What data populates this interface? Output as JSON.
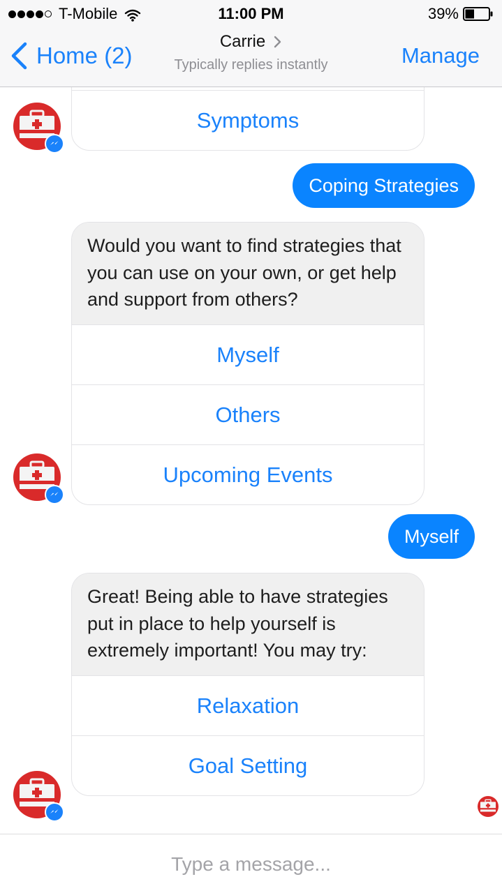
{
  "status_bar": {
    "carrier": "T-Mobile",
    "time": "11:00 PM",
    "battery": "39%",
    "battery_level": 0.39,
    "signal_bars": 4,
    "icons": [
      "signal-dots-icon",
      "wifi-icon",
      "battery-icon"
    ]
  },
  "header": {
    "back_label": "Home (2)",
    "contact_name": "Carrie",
    "subtitle": "Typically replies instantly",
    "manage_label": "Manage"
  },
  "colors": {
    "accent": "#1a82fb",
    "user_bubble": "#0a84ff",
    "bot_avatar": "#d92a2a",
    "bot_text_bg": "#f0f0f0"
  },
  "messages": {
    "card_1": {
      "buttons": [
        "Symptoms"
      ]
    },
    "user_1": "Coping Strategies",
    "card_2": {
      "text": "Would you want to find strategies that you can use on your own, or get help and support from others?",
      "buttons": [
        "Myself",
        "Others",
        "Upcoming Events"
      ]
    },
    "user_2": "Myself",
    "card_3": {
      "text": "Great! Being able to have strategies put in place to help yourself is extremely important! You may try:",
      "buttons": [
        "Relaxation",
        "Goal Setting"
      ]
    }
  },
  "composer": {
    "placeholder": "Type a message..."
  }
}
